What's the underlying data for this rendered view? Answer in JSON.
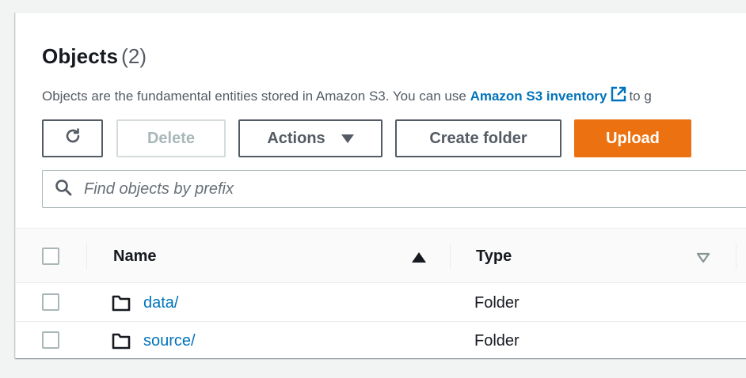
{
  "objects": {
    "title": "Objects",
    "count": "(2)",
    "description_prefix": "Objects are the fundamental entities stored in Amazon S3. You can use ",
    "inventory_link": "Amazon S3 inventory",
    "description_suffix": "to g"
  },
  "toolbar": {
    "refresh_icon": "refresh-icon",
    "delete_label": "Delete",
    "actions_label": "Actions",
    "create_folder_label": "Create folder",
    "upload_label": "Upload"
  },
  "search": {
    "placeholder": "Find objects by prefix",
    "value": ""
  },
  "table": {
    "columns": [
      {
        "label": "Name",
        "sort": "ascending"
      },
      {
        "label": "Type",
        "sort": "none"
      }
    ],
    "rows": [
      {
        "name": "data/",
        "type": "Folder",
        "icon": "folder-icon"
      },
      {
        "name": "source/",
        "type": "Folder",
        "icon": "folder-icon"
      }
    ]
  },
  "colors": {
    "primary": "#ec7211",
    "link": "#0073bb",
    "text": "#16191f",
    "muted": "#545b64",
    "disabled": "#aab7b8"
  }
}
